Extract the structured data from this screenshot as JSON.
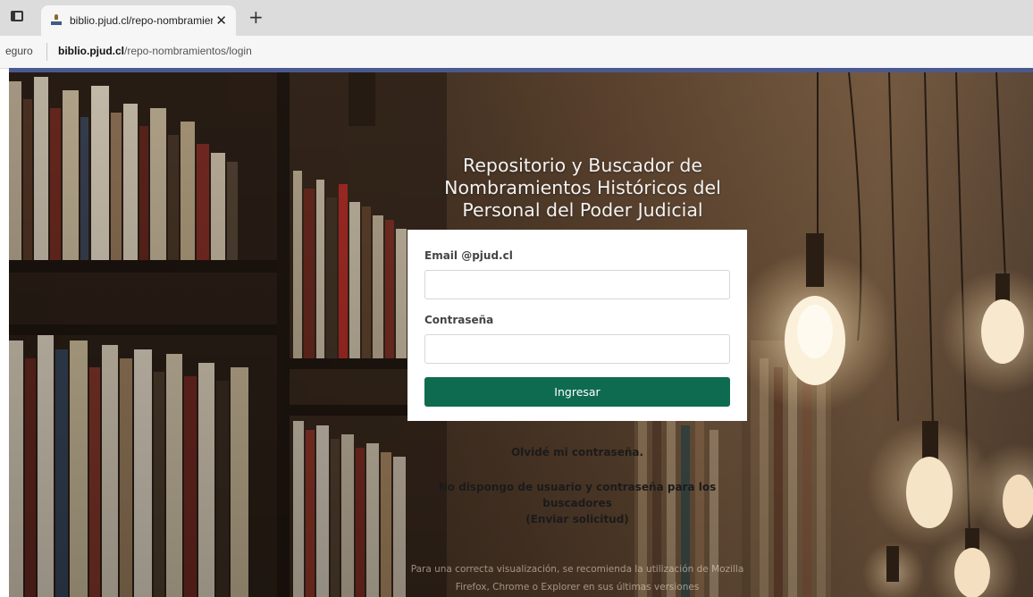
{
  "browser": {
    "tab": {
      "title": "biblio.pjud.cl/repo-nombramientos/login",
      "close_glyph": "✕",
      "favicon": "pjud-favicon-icon"
    },
    "new_tab_glyph": "+",
    "address": {
      "security_label": "eguro",
      "host": "biblio.pjud.cl",
      "path": "/repo-nombramientos/login"
    }
  },
  "page": {
    "heading": "Repositorio y Buscador de Nombramientos Históricos del Personal del Poder Judicial",
    "form": {
      "email_label": "Email @pjud.cl",
      "email_value": "",
      "password_label": "Contraseña",
      "password_value": "",
      "submit_label": "Ingresar"
    },
    "forgot_password": "Olvidé mi contraseña.",
    "no_account_text": "No dispongo de usuario y contraseña para los buscadores",
    "request_link": "(Enviar solicitud)",
    "browser_note": "Para una correcta visualización, se recomienda la utilización de Mozilla Firefox, Chrome o Explorer en sus últimas versiones"
  },
  "colors": {
    "accent_bar": "#4a5a8e",
    "submit_button": "#0e6b4f"
  }
}
